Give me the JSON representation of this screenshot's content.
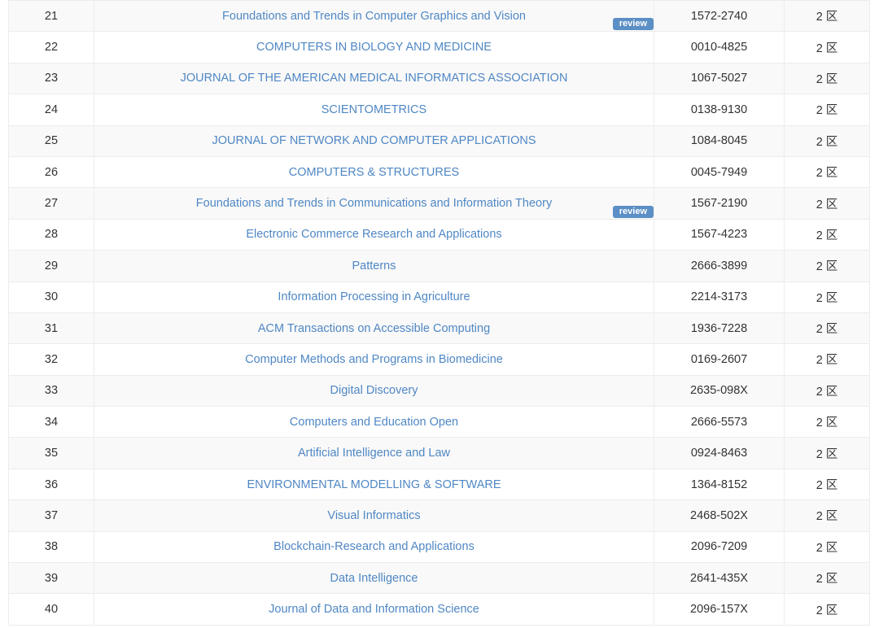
{
  "journal_table": {
    "review_label": "review",
    "rows": [
      {
        "rank": "21",
        "title": "Foundations and Trends in Computer Graphics and Vision",
        "issn": "1572-2740",
        "zone": "2 区",
        "review": true
      },
      {
        "rank": "22",
        "title": "COMPUTERS IN BIOLOGY AND MEDICINE",
        "issn": "0010-4825",
        "zone": "2 区",
        "review": false
      },
      {
        "rank": "23",
        "title": "JOURNAL OF THE AMERICAN MEDICAL INFORMATICS ASSOCIATION",
        "issn": "1067-5027",
        "zone": "2 区",
        "review": false
      },
      {
        "rank": "24",
        "title": "SCIENTOMETRICS",
        "issn": "0138-9130",
        "zone": "2 区",
        "review": false
      },
      {
        "rank": "25",
        "title": "JOURNAL OF NETWORK AND COMPUTER APPLICATIONS",
        "issn": "1084-8045",
        "zone": "2 区",
        "review": false
      },
      {
        "rank": "26",
        "title": "COMPUTERS & STRUCTURES",
        "issn": "0045-7949",
        "zone": "2 区",
        "review": false
      },
      {
        "rank": "27",
        "title": "Foundations and Trends in Communications and Information Theory",
        "issn": "1567-2190",
        "zone": "2 区",
        "review": true
      },
      {
        "rank": "28",
        "title": "Electronic Commerce Research and Applications",
        "issn": "1567-4223",
        "zone": "2 区",
        "review": false
      },
      {
        "rank": "29",
        "title": "Patterns",
        "issn": "2666-3899",
        "zone": "2 区",
        "review": false
      },
      {
        "rank": "30",
        "title": "Information Processing in Agriculture",
        "issn": "2214-3173",
        "zone": "2 区",
        "review": false
      },
      {
        "rank": "31",
        "title": "ACM Transactions on Accessible Computing",
        "issn": "1936-7228",
        "zone": "2 区",
        "review": false
      },
      {
        "rank": "32",
        "title": "Computer Methods and Programs in Biomedicine",
        "issn": "0169-2607",
        "zone": "2 区",
        "review": false
      },
      {
        "rank": "33",
        "title": "Digital Discovery",
        "issn": "2635-098X",
        "zone": "2 区",
        "review": false
      },
      {
        "rank": "34",
        "title": "Computers and Education Open",
        "issn": "2666-5573",
        "zone": "2 区",
        "review": false
      },
      {
        "rank": "35",
        "title": "Artificial Intelligence and Law",
        "issn": "0924-8463",
        "zone": "2 区",
        "review": false
      },
      {
        "rank": "36",
        "title": "ENVIRONMENTAL MODELLING & SOFTWARE",
        "issn": "1364-8152",
        "zone": "2 区",
        "review": false
      },
      {
        "rank": "37",
        "title": "Visual Informatics",
        "issn": "2468-502X",
        "zone": "2 区",
        "review": false
      },
      {
        "rank": "38",
        "title": "Blockchain-Research and Applications",
        "issn": "2096-7209",
        "zone": "2 区",
        "review": false
      },
      {
        "rank": "39",
        "title": "Data Intelligence",
        "issn": "2641-435X",
        "zone": "2 区",
        "review": false
      },
      {
        "rank": "40",
        "title": "Journal of Data and Information Science",
        "issn": "2096-157X",
        "zone": "2 区",
        "review": false
      }
    ]
  },
  "colors": {
    "link": "#4f87c4",
    "badge": "#5b8fc5",
    "stripe": "#f9f9f9",
    "border": "#ececec"
  }
}
